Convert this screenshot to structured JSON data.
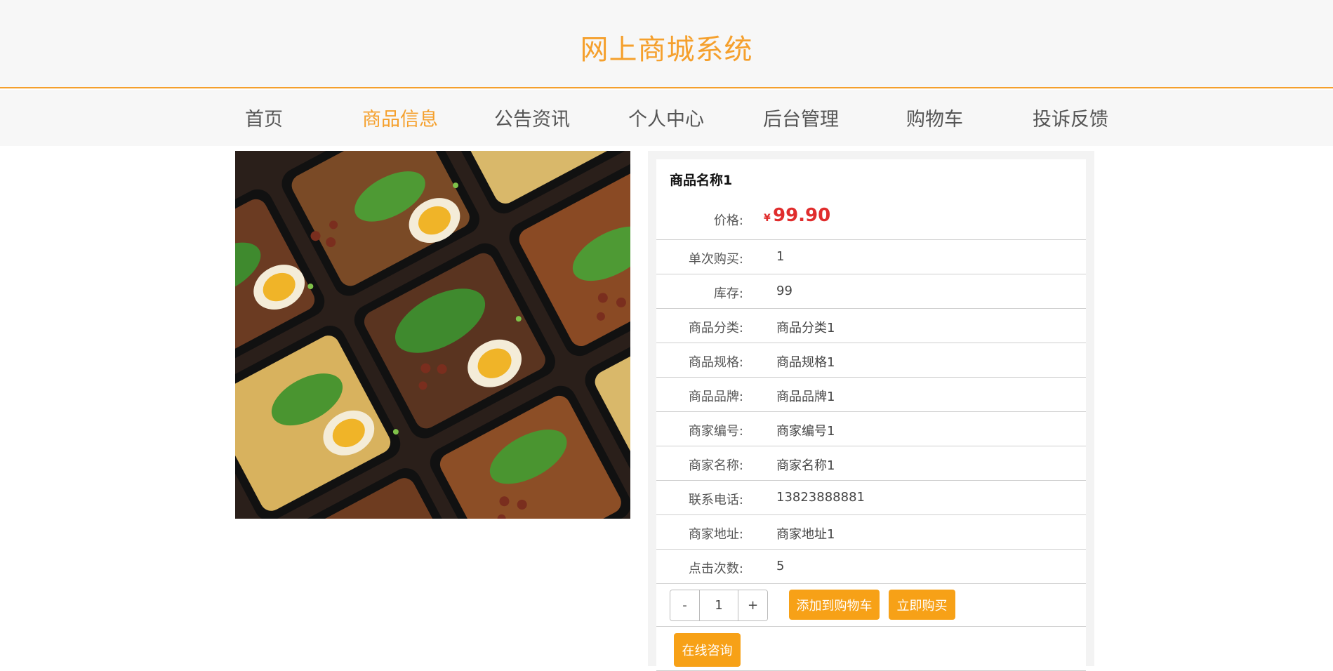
{
  "header": {
    "title": "网上商城系统"
  },
  "nav": {
    "items": [
      {
        "label": "首页"
      },
      {
        "label": "商品信息"
      },
      {
        "label": "公告资讯"
      },
      {
        "label": "个人中心"
      },
      {
        "label": "后台管理"
      },
      {
        "label": "购物车"
      },
      {
        "label": "投诉反馈"
      }
    ],
    "active_index": 1
  },
  "product": {
    "name": "商品名称1",
    "price_label": "价格:",
    "currency_symbol": "¥",
    "price": "99.90",
    "rows": [
      {
        "label": "单次购买:",
        "value": "1"
      },
      {
        "label": "库存:",
        "value": "99"
      },
      {
        "label": "商品分类:",
        "value": "商品分类1"
      },
      {
        "label": "商品规格:",
        "value": "商品规格1"
      },
      {
        "label": "商品品牌:",
        "value": "商品品牌1"
      },
      {
        "label": "商家编号:",
        "value": "商家编号1"
      },
      {
        "label": "商家名称:",
        "value": "商家名称1"
      },
      {
        "label": "联系电话:",
        "value": "13823888881"
      },
      {
        "label": "商家地址:",
        "value": "商家地址1"
      },
      {
        "label": "点击次数:",
        "value": "5"
      }
    ]
  },
  "actions": {
    "decrement": "-",
    "quantity": "1",
    "increment": "+",
    "add_to_cart": "添加到购物车",
    "buy_now": "立即购买",
    "consult": "在线咨询"
  },
  "colors": {
    "accent": "#f5a02d",
    "price": "#e02d2d",
    "button": "#f7a117"
  }
}
